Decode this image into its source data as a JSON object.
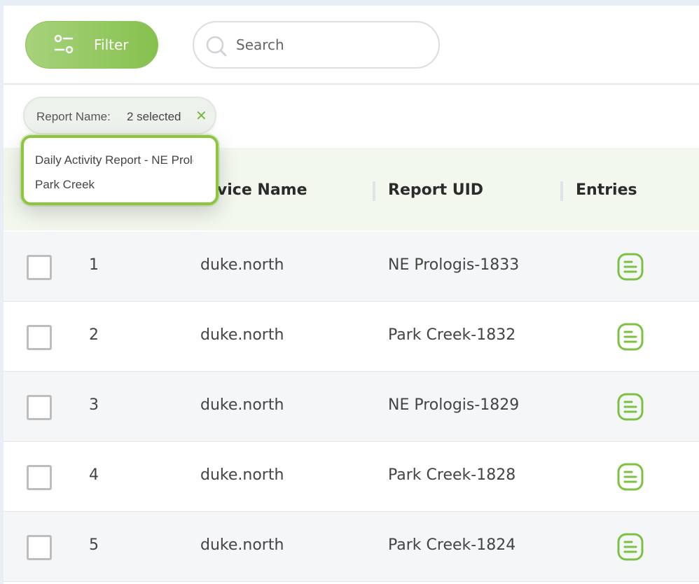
{
  "toolbar": {
    "filter_label": "Filter",
    "search_placeholder": "Search"
  },
  "active_filter": {
    "key": "Report Name:",
    "value": "2 selected",
    "remove_glyph": "✕"
  },
  "dropdown": {
    "options": [
      "Daily Activity Report - NE Prologis",
      "Park Creek"
    ]
  },
  "table": {
    "headers": {
      "device_name": "evice Name",
      "report_uid": "Report UID",
      "entries": "Entries"
    },
    "rows": [
      {
        "index": "1",
        "device": "duke.north",
        "uid": "NE Prologis-1833"
      },
      {
        "index": "2",
        "device": "duke.north",
        "uid": "Park Creek-1832"
      },
      {
        "index": "3",
        "device": "duke.north",
        "uid": "NE Prologis-1829"
      },
      {
        "index": "4",
        "device": "duke.north",
        "uid": "Park Creek-1828"
      },
      {
        "index": "5",
        "device": "duke.north",
        "uid": "Park Creek-1824"
      }
    ]
  },
  "colors": {
    "accent": "#86c14e",
    "accent_border": "#8cc63f",
    "header_bg": "#f3f8ef"
  },
  "icons": {
    "filter": "sliders-icon",
    "search": "search-icon",
    "entries": "document-lines-icon"
  }
}
